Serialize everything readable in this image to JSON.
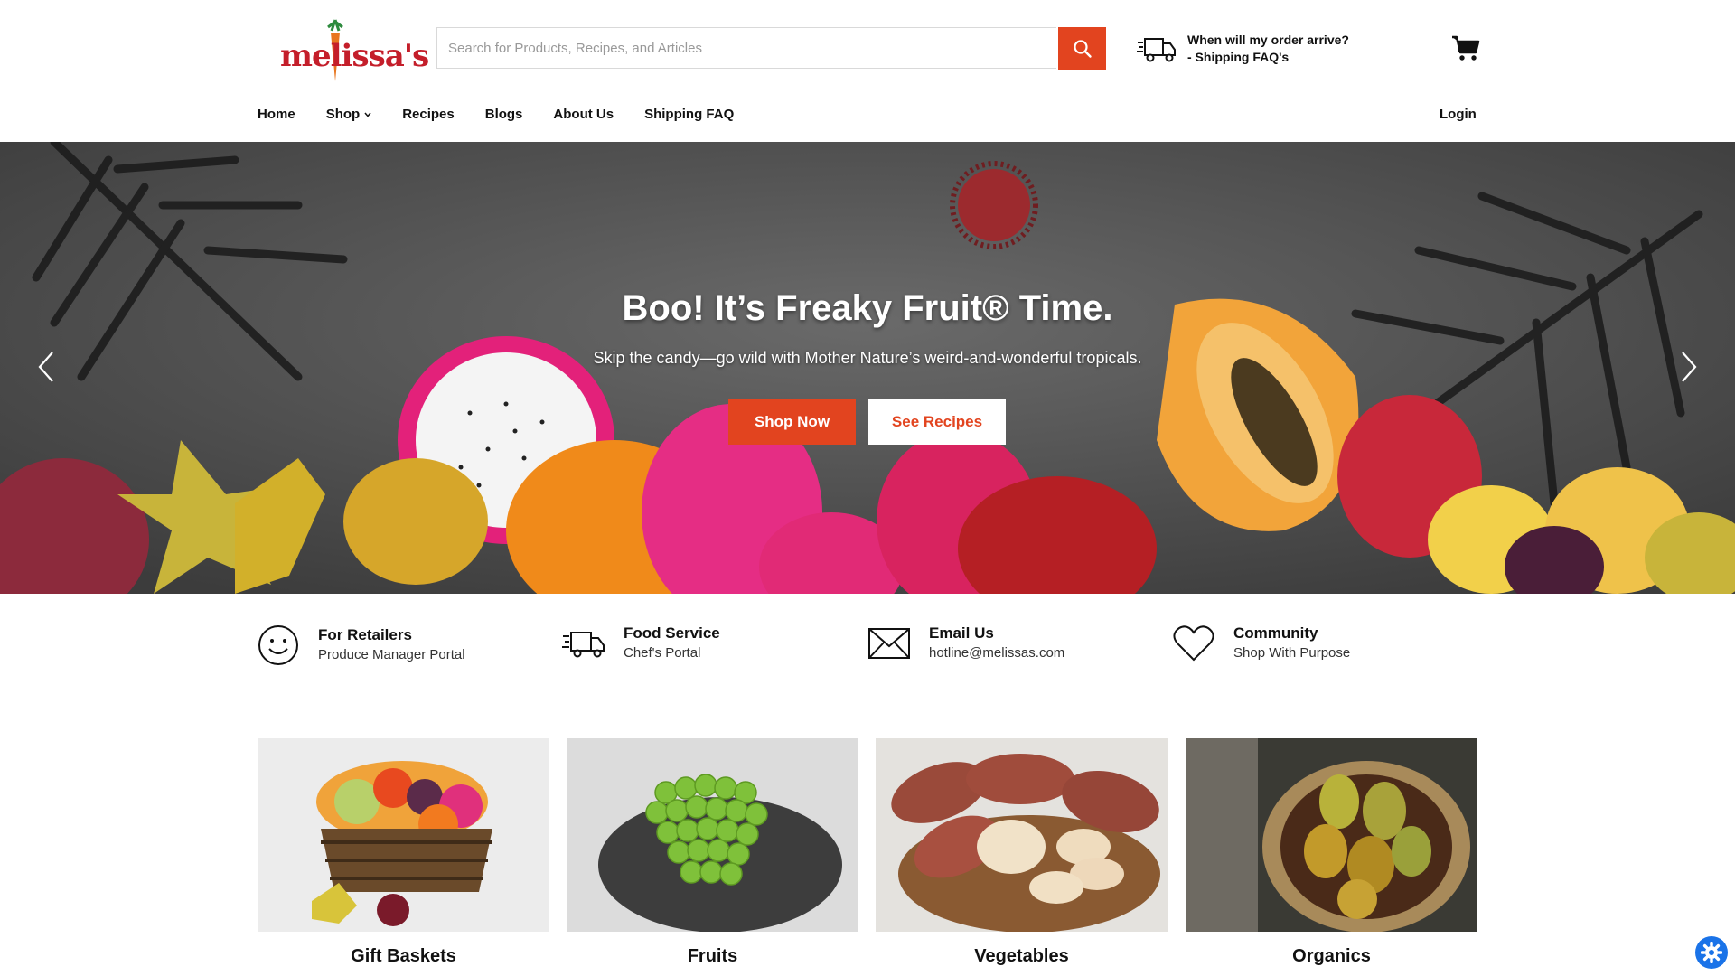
{
  "brand": {
    "logo_text": "melissa's"
  },
  "search": {
    "placeholder": "Search for Products, Recipes, and Articles"
  },
  "shipping": {
    "line1": "When will my order arrive?",
    "line2": "- Shipping FAQ's"
  },
  "nav": {
    "items": [
      {
        "label": "Home"
      },
      {
        "label": "Shop"
      },
      {
        "label": "Recipes"
      },
      {
        "label": "Blogs"
      },
      {
        "label": "About Us"
      },
      {
        "label": "Shipping FAQ"
      }
    ],
    "login": "Login"
  },
  "hero": {
    "title": "Boo! It’s Freaky Fruit® Time.",
    "subtitle": "Skip the candy—go wild with Mother Nature’s weird-and-wonderful tropicals.",
    "primary_btn": "Shop Now",
    "secondary_btn": "See Recipes"
  },
  "info": [
    {
      "title": "For Retailers",
      "subtitle": "Produce Manager Portal",
      "icon": "smiley-icon"
    },
    {
      "title": "Food Service",
      "subtitle": "Chef's Portal",
      "icon": "delivery-truck-icon"
    },
    {
      "title": "Email Us",
      "subtitle": "hotline@melissas.com",
      "icon": "envelope-icon"
    },
    {
      "title": "Community",
      "subtitle": "Shop With Purpose",
      "icon": "heart-icon"
    }
  ],
  "categories": [
    {
      "label": "Gift Baskets"
    },
    {
      "label": "Fruits"
    },
    {
      "label": "Vegetables"
    },
    {
      "label": "Organics"
    }
  ],
  "colors": {
    "accent": "#e2441f",
    "brand_red": "#c41e2a",
    "settings_blue": "#1a73e8"
  }
}
